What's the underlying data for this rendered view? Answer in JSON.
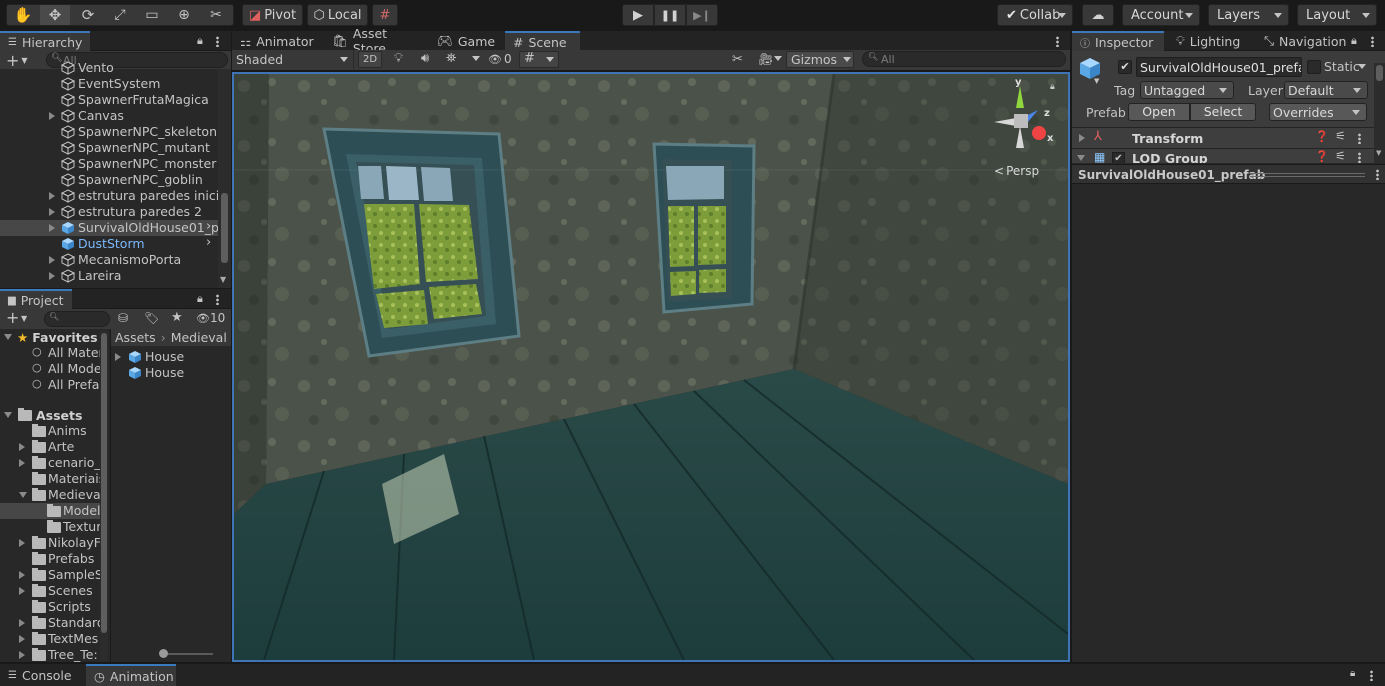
{
  "toolbar": {
    "tools": [
      "hand-tool",
      "move-tool",
      "rotate-tool",
      "scale-tool",
      "rect-tool",
      "transform-tool",
      "custom-tool"
    ],
    "pivot_label": "Pivot",
    "local_label": "Local",
    "collab_label": "Collab",
    "account_label": "Account",
    "layers_label": "Layers",
    "layout_label": "Layout"
  },
  "hierarchy": {
    "title": "Hierarchy",
    "search_placeholder": "All",
    "items": [
      {
        "label": "Vento",
        "expandable": false,
        "selected": false
      },
      {
        "label": "EventSystem",
        "expandable": false,
        "selected": false
      },
      {
        "label": "SpawnerFrutaMagica",
        "expandable": false,
        "selected": false
      },
      {
        "label": "Canvas",
        "expandable": true,
        "selected": false
      },
      {
        "label": "SpawnerNPC_skeleton",
        "expandable": false,
        "selected": false
      },
      {
        "label": "SpawnerNPC_mutant",
        "expandable": false,
        "selected": false
      },
      {
        "label": "SpawnerNPC_monster",
        "expandable": false,
        "selected": false
      },
      {
        "label": "SpawnerNPC_goblin",
        "expandable": false,
        "selected": false
      },
      {
        "label": "estrutura paredes inicial",
        "expandable": true,
        "selected": false
      },
      {
        "label": "estrutura paredes 2",
        "expandable": true,
        "selected": false
      },
      {
        "label": "SurvivalOldHouse01_p",
        "expandable": true,
        "selected": true
      },
      {
        "label": "DustStorm",
        "expandable": false,
        "selected": false,
        "prefab": true
      },
      {
        "label": "MecanismoPorta",
        "expandable": true,
        "selected": false
      },
      {
        "label": "Lareira",
        "expandable": true,
        "selected": false
      }
    ]
  },
  "project": {
    "title": "Project",
    "hidden_count": "10",
    "favorites_label": "Favorites",
    "favorites": [
      "All Materi",
      "All Mode",
      "All Prefa"
    ],
    "assets_label": "Assets",
    "folders": [
      {
        "label": "Anims",
        "expandable": false,
        "indent": 1
      },
      {
        "label": "Arte",
        "expandable": true,
        "indent": 1
      },
      {
        "label": "cenario_",
        "expandable": true,
        "indent": 1
      },
      {
        "label": "Materiais",
        "expandable": false,
        "indent": 1
      },
      {
        "label": "Medieva",
        "expandable": true,
        "expanded": true,
        "indent": 1
      },
      {
        "label": "Model",
        "expandable": false,
        "indent": 2,
        "selected": true
      },
      {
        "label": "Textur",
        "expandable": false,
        "indent": 2
      },
      {
        "label": "NikolayF",
        "expandable": true,
        "indent": 1
      },
      {
        "label": "Prefabs",
        "expandable": false,
        "indent": 1
      },
      {
        "label": "SampleS",
        "expandable": true,
        "indent": 1
      },
      {
        "label": "Scenes",
        "expandable": true,
        "indent": 1
      },
      {
        "label": "Scripts",
        "expandable": false,
        "indent": 1
      },
      {
        "label": "Standard",
        "expandable": true,
        "indent": 1
      },
      {
        "label": "TextMes",
        "expandable": true,
        "indent": 1
      },
      {
        "label": "Tree_Te:",
        "expandable": true,
        "indent": 1
      }
    ],
    "breadcrumb": [
      "Assets",
      "Medieval h"
    ],
    "files": [
      {
        "label": "House",
        "expandable": true
      },
      {
        "label": "House",
        "expandable": false
      }
    ]
  },
  "scene_tabs": [
    "Animator",
    "Asset Store",
    "Game",
    "Scene"
  ],
  "scene_toolbar": {
    "shading": "Shaded",
    "mode_2d": "2D",
    "hidden_count": "0",
    "gizmos_label": "Gizmos",
    "search_placeholder": "All"
  },
  "scene_view": {
    "persp_label": "Persp",
    "gizmo_axes": [
      "y",
      "z",
      "x"
    ]
  },
  "inspector": {
    "tabs": [
      "Inspector",
      "Lighting",
      "Navigation"
    ],
    "object_name": "SurvivalOldHouse01_prefab",
    "static_label": "Static",
    "tag_label": "Tag",
    "tag_value": "Untagged",
    "layer_label": "Layer",
    "layer_value": "Default",
    "prefab_label": "Prefab",
    "open_label": "Open",
    "select_label": "Select",
    "overrides_label": "Overrides",
    "components": [
      "Transform",
      "LOD Group"
    ],
    "preview_title": "SurvivalOldHouse01_prefab"
  },
  "bottom_tabs": [
    "Console",
    "Animation"
  ],
  "colors": {
    "accent": "#3a79bb",
    "prefab_blue": "#7cb9ff",
    "selection": "#2c5d87"
  }
}
